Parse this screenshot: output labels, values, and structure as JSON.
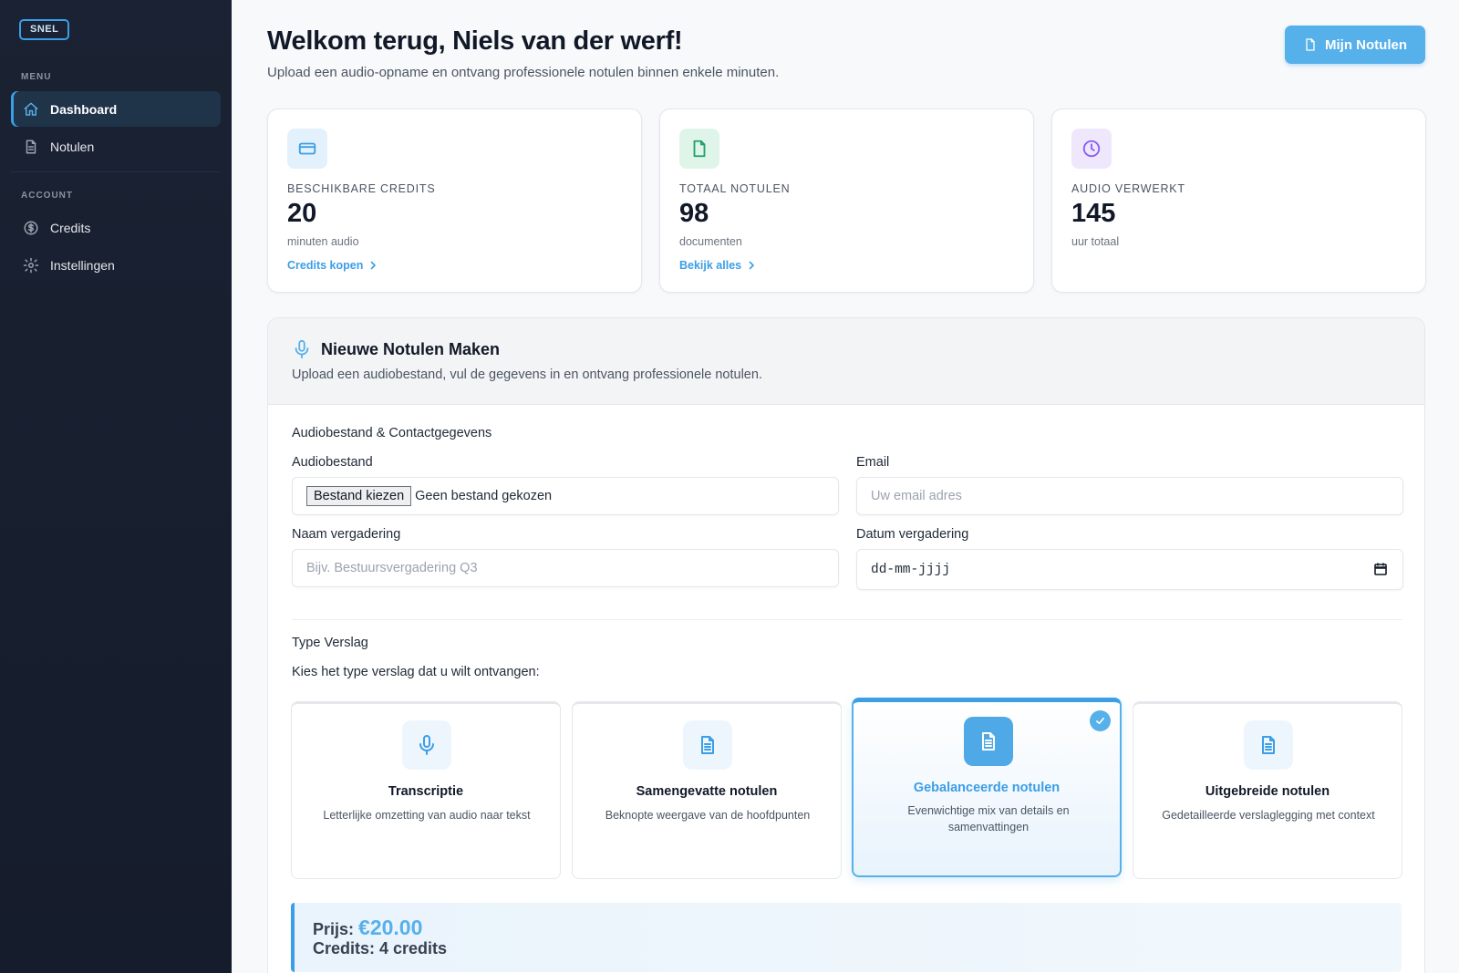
{
  "sidebar": {
    "logo": "SNEL",
    "menu_heading": "MENU",
    "account_heading": "ACCOUNT",
    "items": [
      {
        "label": "Dashboard",
        "icon": "home-icon",
        "active": true
      },
      {
        "label": "Notulen",
        "icon": "document-icon",
        "active": false
      },
      {
        "label": "Credits",
        "icon": "dollar-circle-icon",
        "active": false
      },
      {
        "label": "Instellingen",
        "icon": "gear-icon",
        "active": false
      }
    ]
  },
  "header": {
    "title": "Welkom terug, Niels van der werf!",
    "subtitle": "Upload een audio-opname en ontvang professionele notulen binnen enkele minuten.",
    "primary_button": "Mijn Notulen"
  },
  "stats": [
    {
      "label": "BESCHIKBARE CREDITS",
      "value": "20",
      "unit": "minuten audio",
      "link": "Credits kopen",
      "icon": "credit-card-icon",
      "color": "#3b9ee6"
    },
    {
      "label": "TOTAAL NOTULEN",
      "value": "98",
      "unit": "documenten",
      "link": "Bekijk alles",
      "icon": "file-icon",
      "color": "#22a06b"
    },
    {
      "label": "AUDIO VERWERKT",
      "value": "145",
      "unit": "uur totaal",
      "link": "",
      "icon": "clock-icon",
      "color": "#8b5cf6"
    }
  ],
  "form": {
    "title": "Nieuwe Notulen Maken",
    "subtitle": "Upload een audiobestand, vul de gegevens in en ontvang professionele notulen.",
    "section_title": "Audiobestand & Contactgegevens",
    "audio_label": "Audiobestand",
    "file_button": "Bestand kiezen",
    "file_status": "Geen bestand gekozen",
    "email_label": "Email",
    "email_placeholder": "Uw email adres",
    "meeting_name_label": "Naam vergadering",
    "meeting_name_placeholder": "Bijv. Bestuursvergadering Q3",
    "meeting_date_label": "Datum vergadering",
    "meeting_date_placeholder": "dd-mm-jjjj",
    "report_type_title": "Type Verslag",
    "report_type_prompt": "Kies het type verslag dat u wilt ontvangen:",
    "report_types": [
      {
        "name": "Transcriptie",
        "desc": "Letterlijke omzetting van audio naar tekst",
        "icon": "microphone-icon",
        "selected": false
      },
      {
        "name": "Samengevatte notulen",
        "desc": "Beknopte weergave van de hoofdpunten",
        "icon": "document-lines-icon",
        "selected": false
      },
      {
        "name": "Gebalanceerde notulen",
        "desc": "Evenwichtige mix van details en samenvattingen",
        "icon": "document-lines-icon",
        "selected": true
      },
      {
        "name": "Uitgebreide notulen",
        "desc": "Gedetailleerde verslaglegging met context",
        "icon": "document-lines-icon",
        "selected": false
      }
    ],
    "price_label": "Prijs:",
    "price_value": "€20.00",
    "credits_text": "Credits: 4 credits"
  },
  "colors": {
    "accent": "#3b9ee6",
    "accent_light": "#56b0ea",
    "sidebar_bg": "#1a2233"
  }
}
